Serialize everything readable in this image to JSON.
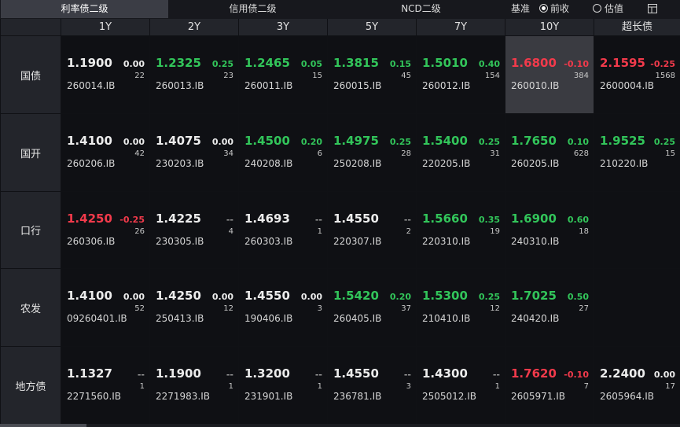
{
  "tabs": [
    {
      "label": "利率债二级",
      "active": true
    },
    {
      "label": "信用债二级",
      "active": false
    },
    {
      "label": "NCD二级",
      "active": false
    }
  ],
  "basis": {
    "label": "基准",
    "options": [
      {
        "label": "前收",
        "selected": true
      },
      {
        "label": "估值",
        "selected": false
      }
    ]
  },
  "tenors": [
    "1Y",
    "2Y",
    "3Y",
    "5Y",
    "7Y",
    "10Y",
    "超长债"
  ],
  "colors": {
    "up": "#f23a4b",
    "down": "#32c55a",
    "flat": "#ececec",
    "highlight": "#3a3b41"
  },
  "rows": [
    {
      "name": "国债",
      "cells": [
        {
          "yield": "1.1900",
          "change": "0.00",
          "count": "22",
          "code": "260014.IB",
          "trend": "flat"
        },
        {
          "yield": "1.2325",
          "change": "0.25",
          "count": "23",
          "code": "260013.IB",
          "trend": "down"
        },
        {
          "yield": "1.2465",
          "change": "0.05",
          "count": "15",
          "code": "260011.IB",
          "trend": "down"
        },
        {
          "yield": "1.3815",
          "change": "0.15",
          "count": "45",
          "code": "260015.IB",
          "trend": "down"
        },
        {
          "yield": "1.5010",
          "change": "0.40",
          "count": "154",
          "code": "260012.IB",
          "trend": "down"
        },
        {
          "yield": "1.6800",
          "change": "-0.10",
          "count": "384",
          "code": "260010.IB",
          "trend": "up",
          "highlight": true
        },
        {
          "yield": "2.1595",
          "change": "-0.25",
          "count": "1568",
          "code": "2600004.IB",
          "trend": "up"
        }
      ]
    },
    {
      "name": "国开",
      "cells": [
        {
          "yield": "1.4100",
          "change": "0.00",
          "count": "42",
          "code": "260206.IB",
          "trend": "flat"
        },
        {
          "yield": "1.4075",
          "change": "0.00",
          "count": "34",
          "code": "230203.IB",
          "trend": "flat"
        },
        {
          "yield": "1.4500",
          "change": "0.20",
          "count": "6",
          "code": "240208.IB",
          "trend": "down"
        },
        {
          "yield": "1.4975",
          "change": "0.25",
          "count": "28",
          "code": "250208.IB",
          "trend": "down"
        },
        {
          "yield": "1.5400",
          "change": "0.25",
          "count": "31",
          "code": "220205.IB",
          "trend": "down"
        },
        {
          "yield": "1.7650",
          "change": "0.10",
          "count": "628",
          "code": "260205.IB",
          "trend": "down"
        },
        {
          "yield": "1.9525",
          "change": "0.25",
          "count": "15",
          "code": "210220.IB",
          "trend": "down"
        }
      ]
    },
    {
      "name": "口行",
      "cells": [
        {
          "yield": "1.4250",
          "change": "-0.25",
          "count": "26",
          "code": "260306.IB",
          "trend": "up"
        },
        {
          "yield": "1.4225",
          "change": "--",
          "count": "4",
          "code": "230305.IB",
          "trend": "flat"
        },
        {
          "yield": "1.4693",
          "change": "--",
          "count": "1",
          "code": "260303.IB",
          "trend": "flat"
        },
        {
          "yield": "1.4550",
          "change": "--",
          "count": "2",
          "code": "220307.IB",
          "trend": "flat"
        },
        {
          "yield": "1.5660",
          "change": "0.35",
          "count": "19",
          "code": "220310.IB",
          "trend": "down"
        },
        {
          "yield": "1.6900",
          "change": "0.60",
          "count": "18",
          "code": "240310.IB",
          "trend": "down"
        },
        null
      ]
    },
    {
      "name": "农发",
      "cells": [
        {
          "yield": "1.4100",
          "change": "0.00",
          "count": "52",
          "code": "09260401.IB",
          "trend": "flat"
        },
        {
          "yield": "1.4250",
          "change": "0.00",
          "count": "12",
          "code": "250413.IB",
          "trend": "flat"
        },
        {
          "yield": "1.4550",
          "change": "0.00",
          "count": "3",
          "code": "190406.IB",
          "trend": "flat"
        },
        {
          "yield": "1.5420",
          "change": "0.20",
          "count": "37",
          "code": "260405.IB",
          "trend": "down"
        },
        {
          "yield": "1.5300",
          "change": "0.25",
          "count": "12",
          "code": "210410.IB",
          "trend": "down"
        },
        {
          "yield": "1.7025",
          "change": "0.50",
          "count": "27",
          "code": "240420.IB",
          "trend": "down"
        },
        null
      ]
    },
    {
      "name": "地方债",
      "cells": [
        {
          "yield": "1.1327",
          "change": "--",
          "count": "1",
          "code": "2271560.IB",
          "trend": "flat"
        },
        {
          "yield": "1.1900",
          "change": "--",
          "count": "1",
          "code": "2271983.IB",
          "trend": "flat"
        },
        {
          "yield": "1.3200",
          "change": "--",
          "count": "1",
          "code": "231901.IB",
          "trend": "flat"
        },
        {
          "yield": "1.4550",
          "change": "--",
          "count": "3",
          "code": "236781.IB",
          "trend": "flat"
        },
        {
          "yield": "1.4300",
          "change": "--",
          "count": "1",
          "code": "2505012.IB",
          "trend": "flat"
        },
        {
          "yield": "1.7620",
          "change": "-0.10",
          "count": "7",
          "code": "2605971.IB",
          "trend": "up"
        },
        {
          "yield": "2.2400",
          "change": "0.00",
          "count": "17",
          "code": "2605964.IB",
          "trend": "flat"
        }
      ]
    }
  ]
}
